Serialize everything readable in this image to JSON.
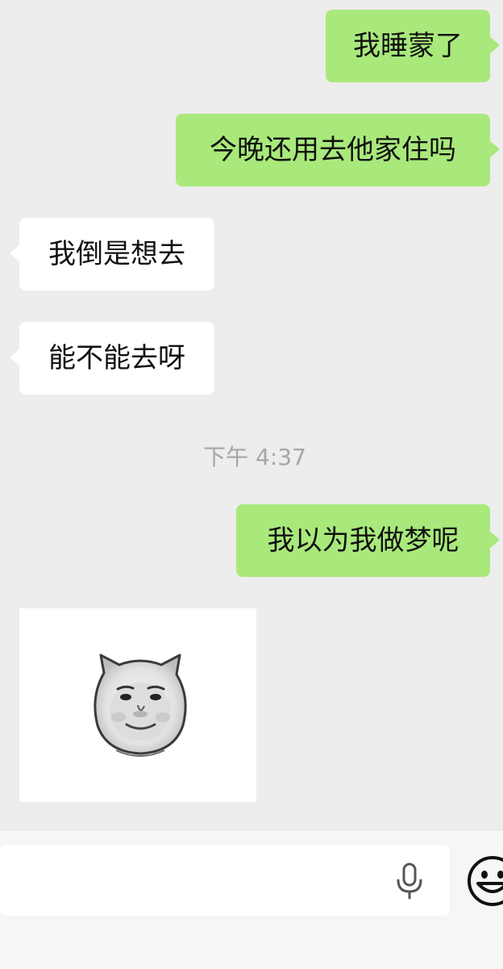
{
  "messages": [
    {
      "side": "me",
      "text": "我睡蒙了"
    },
    {
      "side": "me",
      "text": "今晚还用去他家住吗"
    },
    {
      "side": "them",
      "text": "我倒是想去"
    },
    {
      "side": "them",
      "text": "能不能去呀"
    },
    {
      "side": "me",
      "text": "我以为我做梦呢"
    }
  ],
  "timestamp": "下午 4:37",
  "sticker": {
    "kind": "cat-ear-face-sticker"
  },
  "input": {
    "value": "",
    "placeholder": ""
  },
  "icons": {
    "voice": "microphone-icon",
    "emoji": "emoji-smiley-icon"
  },
  "colors": {
    "my_bubble": "#a9e97b",
    "their_bubble": "#ffffff",
    "background": "#ededed"
  }
}
